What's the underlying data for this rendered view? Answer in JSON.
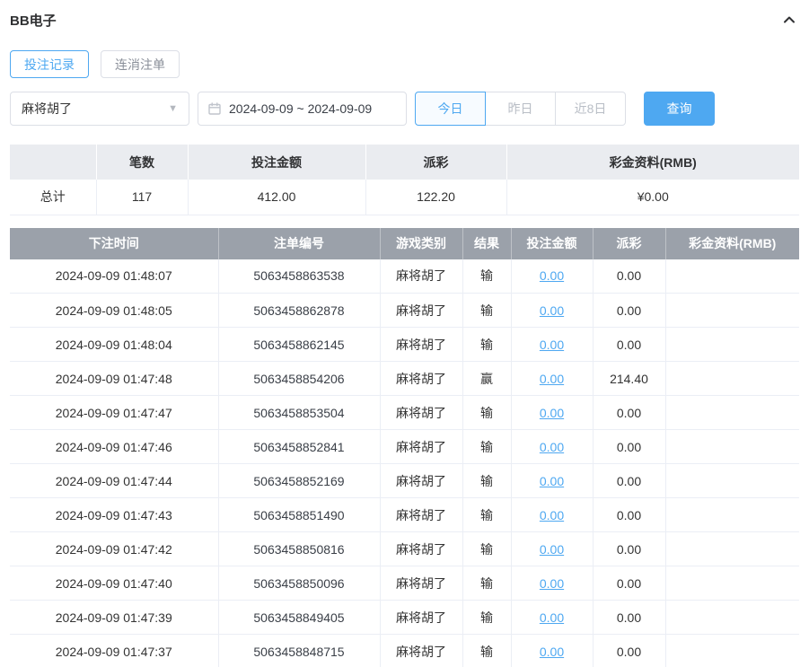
{
  "header": {
    "title": "BB电子"
  },
  "icons": {
    "collapse": "chevron-up-icon",
    "select_caret": "▼",
    "calendar": "calendar-icon"
  },
  "colors": {
    "accent": "#4ea8f1",
    "table_header_bg": "#9ba1aa",
    "summary_header_bg": "#eaecf0"
  },
  "tabs": [
    {
      "label": "投注记录",
      "active": true
    },
    {
      "label": "连消注单",
      "active": false
    }
  ],
  "filters": {
    "game_select_value": "麻将胡了",
    "date_range": "2024-09-09 ~ 2024-09-09",
    "quick_buttons": [
      {
        "label": "今日",
        "active": true
      },
      {
        "label": "昨日",
        "active": false
      },
      {
        "label": "近8日",
        "active": false
      }
    ],
    "search_button": "查询"
  },
  "summary": {
    "headers": [
      "",
      "笔数",
      "投注金额",
      "派彩",
      "彩金资料(RMB)"
    ],
    "row": {
      "label": "总计",
      "count": "117",
      "bet_amount": "412.00",
      "payout": "122.20",
      "bonus": "¥0.00"
    }
  },
  "table": {
    "headers": [
      "下注时间",
      "注单编号",
      "游戏类别",
      "结果",
      "投注金额",
      "派彩",
      "彩金资料(RMB)"
    ],
    "rows": [
      {
        "time": "2024-09-09 01:48:07",
        "order_id": "5063458863538",
        "game_type": "麻将胡了",
        "result": "输",
        "bet": "0.00",
        "payout": "0.00",
        "bonus": ""
      },
      {
        "time": "2024-09-09 01:48:05",
        "order_id": "5063458862878",
        "game_type": "麻将胡了",
        "result": "输",
        "bet": "0.00",
        "payout": "0.00",
        "bonus": ""
      },
      {
        "time": "2024-09-09 01:48:04",
        "order_id": "5063458862145",
        "game_type": "麻将胡了",
        "result": "输",
        "bet": "0.00",
        "payout": "0.00",
        "bonus": ""
      },
      {
        "time": "2024-09-09 01:47:48",
        "order_id": "5063458854206",
        "game_type": "麻将胡了",
        "result": "赢",
        "bet": "0.00",
        "payout": "214.40",
        "bonus": ""
      },
      {
        "time": "2024-09-09 01:47:47",
        "order_id": "5063458853504",
        "game_type": "麻将胡了",
        "result": "输",
        "bet": "0.00",
        "payout": "0.00",
        "bonus": ""
      },
      {
        "time": "2024-09-09 01:47:46",
        "order_id": "5063458852841",
        "game_type": "麻将胡了",
        "result": "输",
        "bet": "0.00",
        "payout": "0.00",
        "bonus": ""
      },
      {
        "time": "2024-09-09 01:47:44",
        "order_id": "5063458852169",
        "game_type": "麻将胡了",
        "result": "输",
        "bet": "0.00",
        "payout": "0.00",
        "bonus": ""
      },
      {
        "time": "2024-09-09 01:47:43",
        "order_id": "5063458851490",
        "game_type": "麻将胡了",
        "result": "输",
        "bet": "0.00",
        "payout": "0.00",
        "bonus": ""
      },
      {
        "time": "2024-09-09 01:47:42",
        "order_id": "5063458850816",
        "game_type": "麻将胡了",
        "result": "输",
        "bet": "0.00",
        "payout": "0.00",
        "bonus": ""
      },
      {
        "time": "2024-09-09 01:47:40",
        "order_id": "5063458850096",
        "game_type": "麻将胡了",
        "result": "输",
        "bet": "0.00",
        "payout": "0.00",
        "bonus": ""
      },
      {
        "time": "2024-09-09 01:47:39",
        "order_id": "5063458849405",
        "game_type": "麻将胡了",
        "result": "输",
        "bet": "0.00",
        "payout": "0.00",
        "bonus": ""
      },
      {
        "time": "2024-09-09 01:47:37",
        "order_id": "5063458848715",
        "game_type": "麻将胡了",
        "result": "输",
        "bet": "0.00",
        "payout": "0.00",
        "bonus": ""
      }
    ]
  }
}
